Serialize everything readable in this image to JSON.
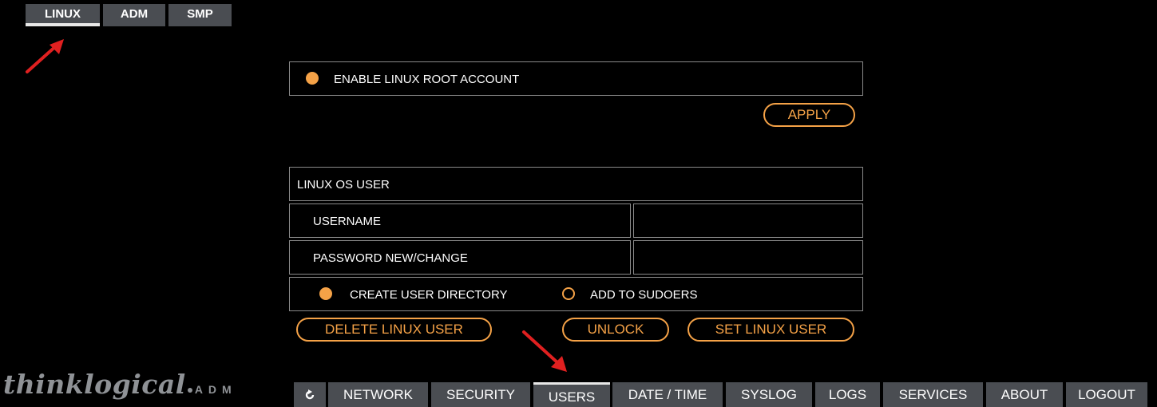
{
  "top_tabs": [
    {
      "label": "LINUX",
      "active": true
    },
    {
      "label": "ADM",
      "active": false
    },
    {
      "label": "SMP",
      "active": false
    }
  ],
  "root_account": {
    "label": "ENABLE LINUX ROOT ACCOUNT",
    "enabled": true,
    "apply_label": "APPLY"
  },
  "os_user": {
    "section_title": "LINUX OS USER",
    "username_label": "USERNAME",
    "username_value": "",
    "password_label": "PASSWORD NEW/CHANGE",
    "password_value": "",
    "create_dir_label": "CREATE USER DIRECTORY",
    "create_dir_checked": true,
    "sudoers_label": "ADD TO SUDOERS",
    "sudoers_checked": false
  },
  "actions": {
    "delete_label": "DELETE LINUX USER",
    "unlock_label": "UNLOCK",
    "set_label": "SET LINUX USER"
  },
  "brand": {
    "logo_text": "thinklogical",
    "sub_text": "ADM"
  },
  "nav": {
    "refresh_icon": "refresh-icon",
    "tabs": [
      {
        "label": "NETWORK",
        "active": false
      },
      {
        "label": "SECURITY",
        "active": false
      },
      {
        "label": "USERS",
        "active": true
      },
      {
        "label": "DATE / TIME",
        "active": false
      },
      {
        "label": "SYSLOG",
        "active": false
      },
      {
        "label": "LOGS",
        "active": false
      },
      {
        "label": "SERVICES",
        "active": false
      },
      {
        "label": "ABOUT",
        "active": false
      },
      {
        "label": "LOGOUT",
        "active": false
      }
    ]
  },
  "colors": {
    "accent": "#f5a247",
    "tab_bg": "#4a4d52",
    "border": "#8a8a8a",
    "annotation_arrow": "#e02020"
  }
}
